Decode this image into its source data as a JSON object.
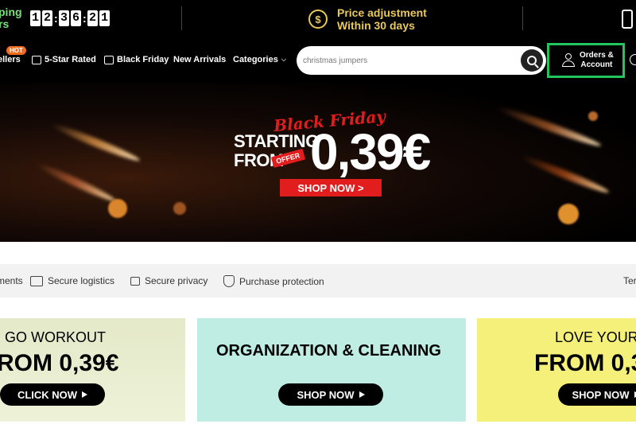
{
  "topbar": {
    "shipping_line1": "ping",
    "shipping_line2": "rs",
    "timer": [
      "1",
      "2",
      "3",
      "6",
      "2",
      "1"
    ],
    "price_title": "Price adjustment",
    "price_subtitle": "Within 30 days",
    "coin_symbol": "$"
  },
  "nav": {
    "hot_badge": "HOT",
    "items": [
      "ellers",
      "5-Star Rated",
      "Black Friday",
      "New Arrivals",
      "Categories"
    ],
    "search_placeholder": "christmas jumpers",
    "account_line1": "Orders &",
    "account_line2": "Account"
  },
  "hero": {
    "script_text": "Black Friday",
    "starting": "STARTING",
    "from": "FROM",
    "offer_tag": "OFFER",
    "price": "0,39€",
    "cta": "SHOP NOW >"
  },
  "trust": {
    "items": [
      "ments",
      "Secure logistics",
      "Secure privacy",
      "Purchase protection",
      "Ter"
    ]
  },
  "cards": [
    {
      "title": "GO WORKOUT",
      "subtitle": "ROM 0,39€",
      "cta": "CLICK NOW"
    },
    {
      "title": "ORGANIZATION & CLEANING",
      "cta": "SHOP NOW"
    },
    {
      "title": "LOVE YOUR",
      "subtitle": "FROM 0,3",
      "cta": "SHOP NOW"
    }
  ],
  "colors": {
    "accent_green": "#22c55e",
    "gold": "#e8c95a",
    "brand_red": "#e11d1d",
    "hot_orange": "#f26b1d"
  }
}
